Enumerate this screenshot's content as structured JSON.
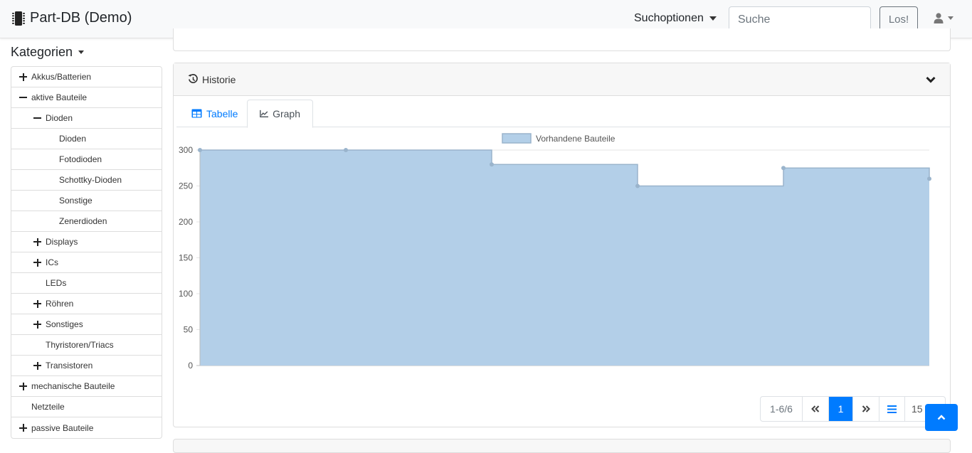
{
  "navbar": {
    "title": "Part-DB (Demo)",
    "search_options_label": "Suchoptionen",
    "search_placeholder": "Suche",
    "go_label": "Los!"
  },
  "sidebar": {
    "title": "Kategorien",
    "items": [
      {
        "label": "Akkus/Batterien",
        "level": 0,
        "state": "collapsed"
      },
      {
        "label": "aktive Bauteile",
        "level": 0,
        "state": "expanded"
      },
      {
        "label": "Dioden",
        "level": 1,
        "state": "expanded"
      },
      {
        "label": "Dioden",
        "level": 2,
        "state": "leaf"
      },
      {
        "label": "Fotodioden",
        "level": 2,
        "state": "leaf"
      },
      {
        "label": "Schottky-Dioden",
        "level": 2,
        "state": "leaf"
      },
      {
        "label": "Sonstige",
        "level": 2,
        "state": "leaf"
      },
      {
        "label": "Zenerdioden",
        "level": 2,
        "state": "leaf"
      },
      {
        "label": "Displays",
        "level": 1,
        "state": "collapsed"
      },
      {
        "label": "ICs",
        "level": 1,
        "state": "collapsed"
      },
      {
        "label": "LEDs",
        "level": 1,
        "state": "leaf"
      },
      {
        "label": "Röhren",
        "level": 1,
        "state": "collapsed"
      },
      {
        "label": "Sonstiges",
        "level": 1,
        "state": "collapsed"
      },
      {
        "label": "Thyristoren/Triacs",
        "level": 1,
        "state": "leaf"
      },
      {
        "label": "Transistoren",
        "level": 1,
        "state": "collapsed"
      },
      {
        "label": "mechanische Bauteile",
        "level": 0,
        "state": "collapsed"
      },
      {
        "label": "Netzteile",
        "level": 0,
        "state": "leaf"
      },
      {
        "label": "passive Bauteile",
        "level": 0,
        "state": "collapsed"
      }
    ]
  },
  "history": {
    "title": "Historie",
    "tabs": [
      {
        "label": "Tabelle",
        "active": false
      },
      {
        "label": "Graph",
        "active": true
      }
    ]
  },
  "pagination": {
    "info": "1-6/6",
    "current_page": "1",
    "page_size": "15"
  },
  "colors": {
    "accent": "#007bff",
    "area_fill": "#b3cfe8",
    "area_stroke": "#9ab4cc"
  },
  "chart_data": {
    "type": "area",
    "step": true,
    "series": [
      {
        "name": "Vorhandene Bauteile",
        "values": [
          300,
          300,
          280,
          250,
          275,
          260
        ]
      }
    ],
    "ylim": [
      0,
      300
    ],
    "yticks": [
      0,
      50,
      100,
      150,
      200,
      250,
      300
    ],
    "legend": "top-center",
    "grid": true
  }
}
